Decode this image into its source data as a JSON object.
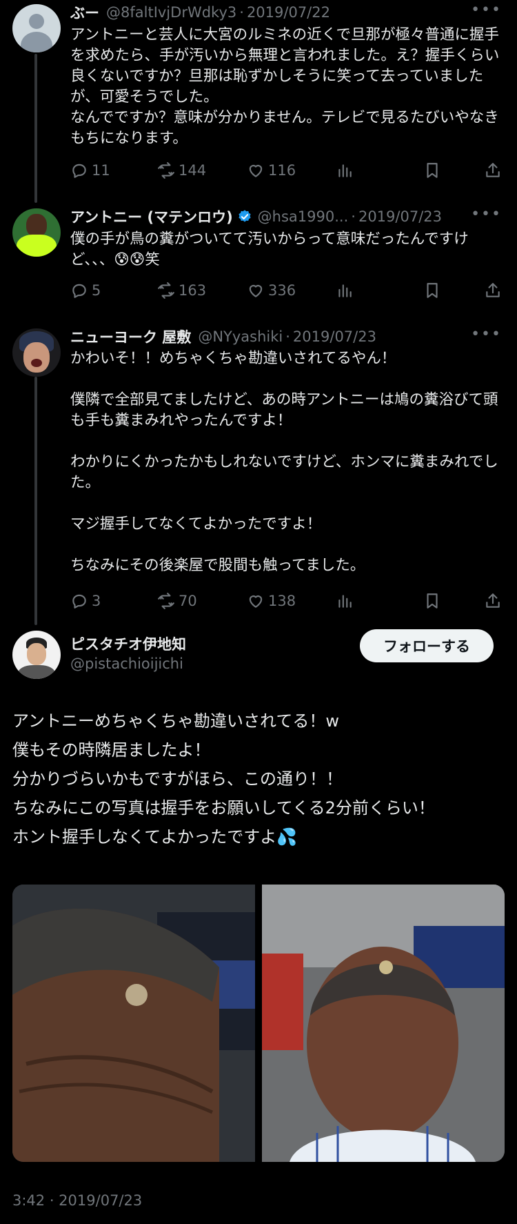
{
  "thread": [
    {
      "name": "ぶー",
      "handle": "@8faltIvjDrWdky3",
      "date": "2019/07/22",
      "text": "アントニーと芸人に大宮のルミネの近くで旦那が極々普通に握手を求めたら、手が汚いから無理と言われました。え？握手くらい良くないですか？旦那は恥ずかしそうに笑って去っていましたが、可愛そうでした。\nなんでですか？意味が分かりません。テレビで見るたびいやなきもちになります。",
      "replies": "11",
      "reposts": "144",
      "likes": "116"
    },
    {
      "name": "アントニー (マテンロウ)",
      "handle": "@hsa1990...",
      "date": "2019/07/23",
      "text": "僕の手が鳥の糞がついてて汚いからって意味だったんですけど、、、😰😰笑",
      "replies": "5",
      "reposts": "163",
      "likes": "336"
    },
    {
      "name": "ニューヨーク 屋敷",
      "handle": "@NYyashiki",
      "date": "2019/07/23",
      "text": "かわいそ！！めちゃくちゃ勘違いされてるやん！\n\n僕隣で全部見てましたけど、あの時アントニーは鳩の糞浴びて頭も手も糞まみれやったんですよ！\n\nわかりにくかったかもしれないですけど、ホンマに糞まみれでした。\n\nマジ握手してなくてよかったですよ！\n\nちなみにその後楽屋で股間も触ってました。",
      "replies": "3",
      "reposts": "70",
      "likes": "138"
    }
  ],
  "main": {
    "name": "ピスタチオ伊地知",
    "handle": "@pistachioijichi",
    "follow_label": "フォローする",
    "text": "アントニーめちゃくちゃ勘違いされてる！w\n僕もその時隣居ましたよ！\n分かりづらいかもですがほら、この通り！！\nちなみにこの写真は握手をお願いしてくる2分前くらい！\nホント握手しなくてよかったですよ💦",
    "timestamp": "3:42 · 2019/07/23"
  },
  "separator": "·",
  "more_glyph": "•••",
  "colors": {
    "background": "#000000",
    "text": "#e7e9ea",
    "muted": "#71767b",
    "verified": "#1d9bf0",
    "thread_line": "#333639"
  },
  "icons": [
    "reply-icon",
    "repost-icon",
    "like-icon",
    "views-icon",
    "bookmark-icon",
    "share-icon",
    "verified-badge-icon",
    "more-icon"
  ]
}
